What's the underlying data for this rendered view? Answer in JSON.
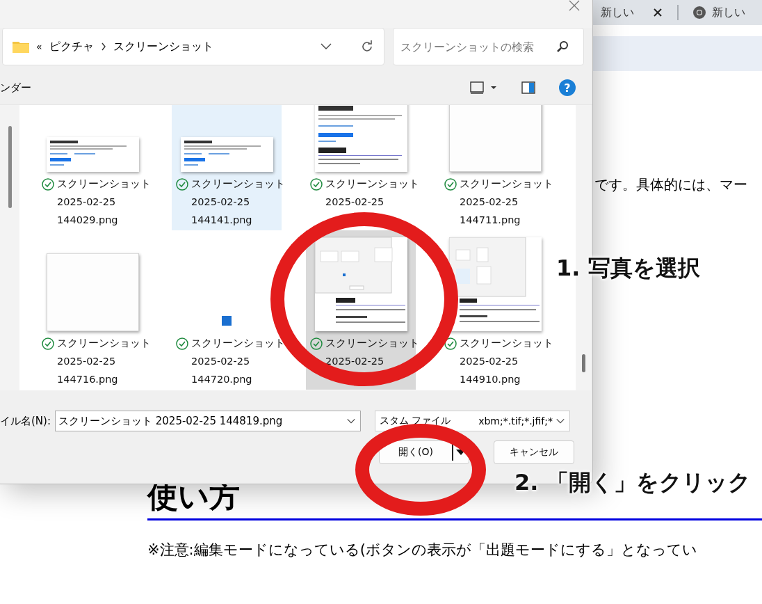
{
  "browser": {
    "tabs": [
      {
        "title": "新しい",
        "selected": false,
        "favicon": false,
        "close_button": true
      },
      {
        "title": "新しい",
        "selected": false,
        "favicon": true,
        "close_button": false
      }
    ]
  },
  "page": {
    "text_line": "です。具体的には、マー",
    "heading": "使い方",
    "note": "※注意:編集モードになっている(ボタンの表示が「出題モードにする」となってい"
  },
  "dialog": {
    "overflow": "«",
    "breadcrumb": [
      "ピクチャ",
      "スクリーンショット"
    ],
    "search": {
      "placeholder": "スクリーンショットの検索"
    },
    "toolbar_label": "ンダー",
    "help": "?",
    "files": [
      {
        "kind": "page",
        "lines": [
          "スクリーンショット",
          "2025-02-25",
          "144029.png"
        ],
        "selected": false,
        "hovered": false
      },
      {
        "kind": "page",
        "lines": [
          "スクリーンショット",
          "2025-02-25",
          "144141.png"
        ],
        "selected": false,
        "hovered": true
      },
      {
        "kind": "tall",
        "lines": [
          "スクリーンショット",
          "2025-02-25"
        ],
        "selected": false,
        "hovered": false
      },
      {
        "kind": "blank",
        "lines": [
          "スクリーンショット",
          "2025-02-25",
          "144711.png"
        ],
        "selected": false,
        "hovered": false
      },
      {
        "kind": "blank",
        "lines": [
          "スクリーンショット",
          "2025-02-25",
          "144716.png"
        ],
        "selected": false,
        "hovered": false
      },
      {
        "kind": "icon",
        "lines": [
          "スクリーンショット",
          "2025-02-25",
          "144720.png"
        ],
        "selected": false,
        "hovered": false
      },
      {
        "kind": "dialog",
        "lines": [
          "スクリーンショット",
          "2025-02-25"
        ],
        "selected": true,
        "hovered": false
      },
      {
        "kind": "site",
        "lines": [
          "スクリーンショット",
          "2025-02-25",
          "144910.png"
        ],
        "selected": false,
        "hovered": false
      }
    ],
    "filename_label": "イル名(N):",
    "filename": {
      "value": "スクリーンショット 2025-02-25 144819.png"
    },
    "filter": {
      "start": "スタム ファイル",
      "end": "xbm;*.tif;*.jfif;*"
    },
    "open_button": "開く(O)",
    "cancel_button": "キャンセル"
  },
  "annotations": [
    {
      "number": "1.",
      "text": "写真を選択"
    },
    {
      "number": "2.",
      "text": "「開く」をクリック"
    }
  ]
}
